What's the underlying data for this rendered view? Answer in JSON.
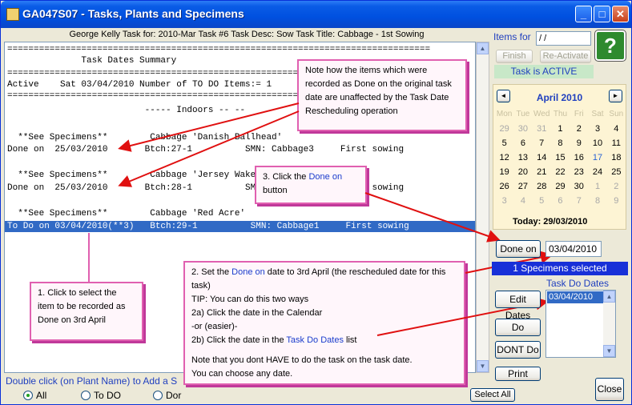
{
  "window": {
    "title": "GA047S07 - Tasks, Plants and Specimens",
    "minimize": "_",
    "maximize": "□",
    "close": "✕"
  },
  "header": {
    "text": "George Kelly Task for: 2010-Mar Task #6 Task Desc: Sow Task Title: Cabbage - 1st Sowing"
  },
  "report": {
    "lines": [
      "================================================================================",
      "              Task Dates Summary",
      "================================================================================",
      "Active    Sat 03/04/2010 Number of TO DO Items:= 1",
      "================================================================================",
      "                          ----- Indoors -- --",
      "",
      "  **See Specimens**        Cabbage 'Danish Ballhead'",
      "Done on  25/03/2010       Btch:27-1          SMN: Cabbage3     First sowing",
      "",
      "  **See Specimens**        Cabbage 'Jersey Wakefield'",
      "Done on  25/03/2010       Btch:28-1          SMN: Cabbage2     First sowing",
      "",
      "  **See Specimens**        Cabbage 'Red Acre'",
      "To Do on 03/04/2010(**3)   Btch:29-1          SMN: Cabbage1     First sowing"
    ]
  },
  "callouts": {
    "note": "Note how the items which were recorded as Done on the original task date are unaffected by the Task Date Rescheduling operation",
    "step1": "1. Click to select the item to be recorded as Done on 3rd April",
    "step3_a": "3. Click the ",
    "step3_b": "Done on",
    "step3_c": " button",
    "step2_a": "2. Set the ",
    "step2_b": "Done on",
    "step2_c": " date to 3rd April (the rescheduled date for this task)",
    "step2_tip": "TIP: You can do this two ways",
    "step2_2a": "2a) Click the date in the Calendar",
    "step2_or": "-or (easier)-",
    "step2_2b_a": "2b) Click the date in the ",
    "step2_2b_b": "Task Do Dates",
    "step2_2b_c": " list",
    "step2_note1": "Note that you dont HAVE to do the task on the task date.",
    "step2_note2": "You can choose any date."
  },
  "footer": {
    "hint": "Double click (on Plant Name) to Add a S",
    "filters": [
      "All",
      "To DO",
      "Dor"
    ],
    "selected_filter": "All",
    "select_all": "Select All"
  },
  "right": {
    "items_for_label": "Items for",
    "items_for_value": "/ /",
    "finish": "Finish",
    "reactivate": "Re-Activate",
    "status": "Task is ACTIVE",
    "help": "?",
    "calendar": {
      "month": "April 2010",
      "prev": "◄",
      "next": "►",
      "weekdays": [
        "Mon",
        "Tue",
        "Wed",
        "Thu",
        "Fri",
        "Sat",
        "Sun"
      ],
      "weeks": [
        [
          "29",
          "30",
          "31",
          "1",
          "2",
          "3",
          "4"
        ],
        [
          "5",
          "6",
          "7",
          "8",
          "9",
          "10",
          "11"
        ],
        [
          "12",
          "13",
          "14",
          "15",
          "16",
          "17",
          "18"
        ],
        [
          "19",
          "20",
          "21",
          "22",
          "23",
          "24",
          "25"
        ],
        [
          "26",
          "27",
          "28",
          "29",
          "30",
          "1",
          "2"
        ],
        [
          "3",
          "4",
          "5",
          "6",
          "7",
          "8",
          "9"
        ]
      ],
      "today_label": "Today: 29/03/2010"
    },
    "done_on": "Done on",
    "done_on_date": "03/04/2010",
    "specimens_selected": "1 Specimens selected",
    "task_do_dates_label": "Task Do Dates",
    "task_do_dates": [
      "03/04/2010"
    ],
    "edit_dates": "Edit Dates",
    "do": "Do",
    "dont_do": "DONT Do",
    "print": "Print",
    "close": "Close"
  },
  "colors": {
    "selection": "#316ac5",
    "status_bg": "#c8e8c8",
    "specimens_bg": "#1830d8",
    "callout_border": "#e060b0",
    "arrow": "#e01010"
  }
}
